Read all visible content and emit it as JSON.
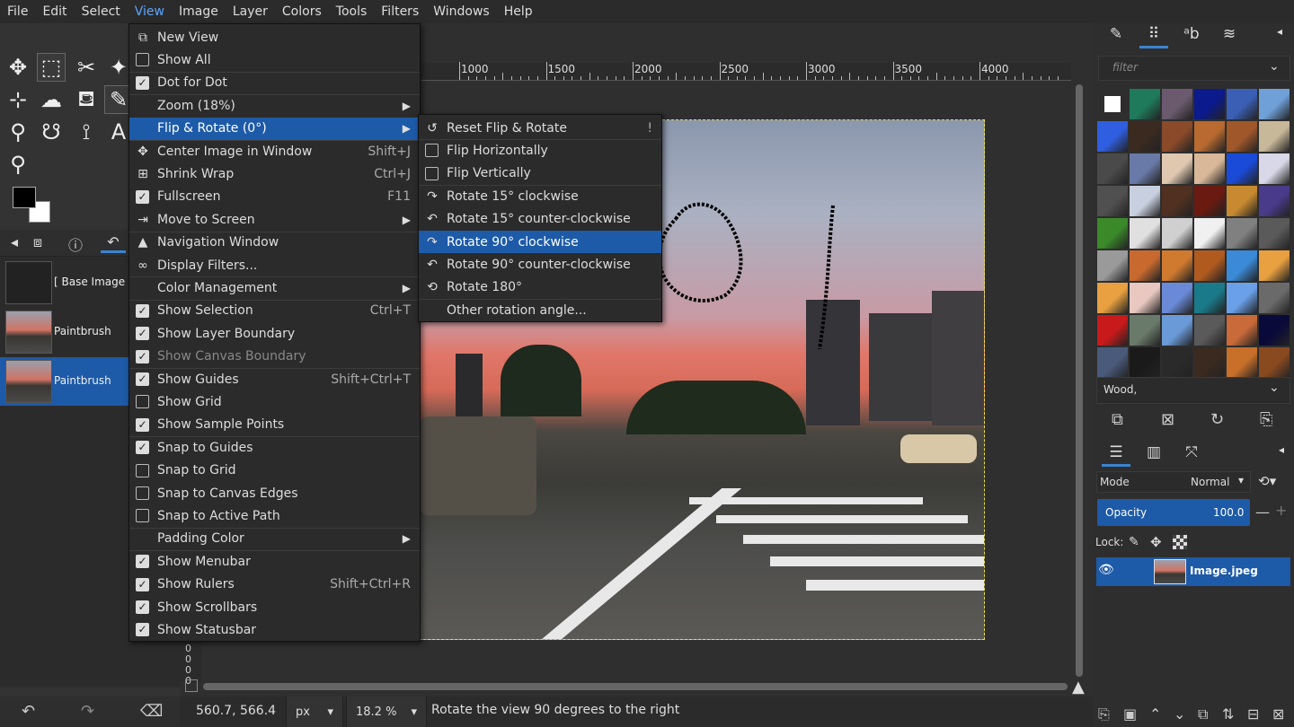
{
  "menubar": [
    "File",
    "Edit",
    "Select",
    "View",
    "Image",
    "Layer",
    "Colors",
    "Tools",
    "Filters",
    "Windows",
    "Help"
  ],
  "view_menu": {
    "items": [
      {
        "label": "New View",
        "type": "icon",
        "icon": "new-view-icon",
        "glyph": "⧉",
        "shortcut": ""
      },
      {
        "label": "Show All",
        "type": "check",
        "checked": false,
        "shortcut": ""
      },
      {
        "label": "Dot for Dot",
        "type": "check",
        "checked": true,
        "shortcut": ""
      },
      {
        "label": "Zoom (18%)",
        "type": "plain",
        "submenu": true,
        "shortcut": ""
      },
      {
        "label": "Flip & Rotate (0°)",
        "type": "plain",
        "submenu": true,
        "highlight": true,
        "shortcut": ""
      },
      {
        "label": "Center Image in Window",
        "type": "icon",
        "icon": "center-icon",
        "glyph": "✥",
        "shortcut": "Shift+J"
      },
      {
        "label": "Shrink Wrap",
        "type": "icon",
        "icon": "shrink-wrap-icon",
        "glyph": "⊞",
        "shortcut": "Ctrl+J"
      },
      {
        "label": "Fullscreen",
        "type": "check",
        "checked": true,
        "shortcut": "F11"
      },
      {
        "label": "Move to Screen",
        "type": "icon",
        "icon": "move-screen-icon",
        "glyph": "⇥",
        "submenu": true,
        "shortcut": ""
      },
      {
        "label": "Navigation Window",
        "type": "icon",
        "icon": "navigation-icon",
        "glyph": "▲",
        "shortcut": ""
      },
      {
        "label": "Display Filters...",
        "type": "icon",
        "icon": "display-filters-icon",
        "glyph": "∞",
        "shortcut": ""
      },
      {
        "label": "Color Management",
        "type": "plain",
        "submenu": true,
        "shortcut": ""
      },
      {
        "label": "Show Selection",
        "type": "check",
        "checked": true,
        "shortcut": "Ctrl+T"
      },
      {
        "label": "Show Layer Boundary",
        "type": "check",
        "checked": true,
        "shortcut": ""
      },
      {
        "label": "Show Canvas Boundary",
        "type": "check",
        "checked": true,
        "disabled": true,
        "shortcut": ""
      },
      {
        "label": "Show Guides",
        "type": "check",
        "checked": true,
        "shortcut": "Shift+Ctrl+T"
      },
      {
        "label": "Show Grid",
        "type": "check",
        "checked": false,
        "shortcut": ""
      },
      {
        "label": "Show Sample Points",
        "type": "check",
        "checked": true,
        "shortcut": ""
      },
      {
        "label": "Snap to Guides",
        "type": "check",
        "checked": true,
        "shortcut": ""
      },
      {
        "label": "Snap to Grid",
        "type": "check",
        "checked": false,
        "shortcut": ""
      },
      {
        "label": "Snap to Canvas Edges",
        "type": "check",
        "checked": false,
        "shortcut": ""
      },
      {
        "label": "Snap to Active Path",
        "type": "check",
        "checked": false,
        "shortcut": ""
      },
      {
        "label": "Padding Color",
        "type": "plain",
        "submenu": true,
        "shortcut": ""
      },
      {
        "label": "Show Menubar",
        "type": "check",
        "checked": true,
        "shortcut": ""
      },
      {
        "label": "Show Rulers",
        "type": "check",
        "checked": true,
        "shortcut": "Shift+Ctrl+R"
      },
      {
        "label": "Show Scrollbars",
        "type": "check",
        "checked": true,
        "shortcut": ""
      },
      {
        "label": "Show Statusbar",
        "type": "check",
        "checked": true,
        "shortcut": ""
      }
    ]
  },
  "flip_rotate_menu": {
    "items": [
      {
        "label": "Reset Flip & Rotate",
        "type": "icon",
        "icon": "reset-rotate-icon",
        "glyph": "↺",
        "shortcut": "!"
      },
      {
        "label": "Flip Horizontally",
        "type": "check",
        "checked": false,
        "shortcut": ""
      },
      {
        "label": "Flip Vertically",
        "type": "check",
        "checked": false,
        "shortcut": ""
      },
      {
        "label": "Rotate 15° clockwise",
        "type": "icon",
        "icon": "rotate-cw-icon",
        "glyph": "↷",
        "shortcut": ""
      },
      {
        "label": "Rotate 15° counter-clockwise",
        "type": "icon",
        "icon": "rotate-ccw-icon",
        "glyph": "↶",
        "shortcut": ""
      },
      {
        "label": "Rotate 90° clockwise",
        "type": "icon",
        "icon": "rotate-cw-icon",
        "glyph": "↷",
        "highlight": true,
        "shortcut": ""
      },
      {
        "label": "Rotate 90° counter-clockwise",
        "type": "icon",
        "icon": "rotate-ccw-icon",
        "glyph": "↶",
        "shortcut": ""
      },
      {
        "label": "Rotate 180°",
        "type": "icon",
        "icon": "rotate-180-icon",
        "glyph": "⟲",
        "shortcut": ""
      },
      {
        "label": "Other rotation angle...",
        "type": "plain",
        "shortcut": ""
      }
    ]
  },
  "ruler": {
    "labels": [
      "1000",
      "1500",
      "2000",
      "2500",
      "3000",
      "3500",
      "4000"
    ]
  },
  "vruler_labels": [
    "0",
    "0",
    "0",
    "0"
  ],
  "history": {
    "items": [
      {
        "label": "[ Base Image ]",
        "thumb": "blank"
      },
      {
        "label": "Paintbrush",
        "thumb": "image"
      },
      {
        "label": "Paintbrush",
        "thumb": "image",
        "selected": true
      }
    ]
  },
  "status": {
    "coords": "560.7, 566.4",
    "unit": "px",
    "zoom": "18.2 %",
    "message": "Rotate the view 90 degrees to the right"
  },
  "patterns": {
    "filter_placeholder": "filter",
    "selected_name": "Wood,",
    "colors": [
      "#ffffff",
      "#1f7a5c",
      "#6b5a6e",
      "#0b1a8c",
      "#3b5fb5",
      "#6fa0d8",
      "#2f5ee0",
      "#3a2a20",
      "#8b4a2a",
      "#b86a30",
      "#a0582a",
      "#c8b89a",
      "#4a4a4a",
      "#6a7aa8",
      "#e0c8b0",
      "#d8b898",
      "#1a4ad8",
      "#d8d8e8",
      "#505050",
      "#c8d0e0",
      "#503020",
      "#6a1a10",
      "#c88a30",
      "#4a3a8a",
      "#3a8a2a",
      "#e0e0e0",
      "#d0d0d0",
      "#f0f0f0",
      "#808080",
      "#5a5a5a",
      "#9a9a9a",
      "#c86a30",
      "#d07a30",
      "#b05a20",
      "#3a8ad8",
      "#e8a040",
      "#e8a040",
      "#e8c8c0",
      "#6a8ad8",
      "#1a7a8a",
      "#6aa0e8",
      "#6a6a6a",
      "#c81a1a",
      "#6a7a6a",
      "#6a9ad8",
      "#5a5a5a",
      "#c86a3a",
      "#0a0a3a",
      "#4a5a7a",
      "#1a1a1a",
      "#2a2a2a",
      "#3a2a20",
      "#c8702a",
      "#8a4a20"
    ]
  },
  "layers": {
    "mode_label": "Mode",
    "mode_value": "Normal",
    "opacity_label": "Opacity",
    "opacity_value": "100.0",
    "lock_label": "Lock:",
    "layer_name": "Image.jpeg"
  }
}
